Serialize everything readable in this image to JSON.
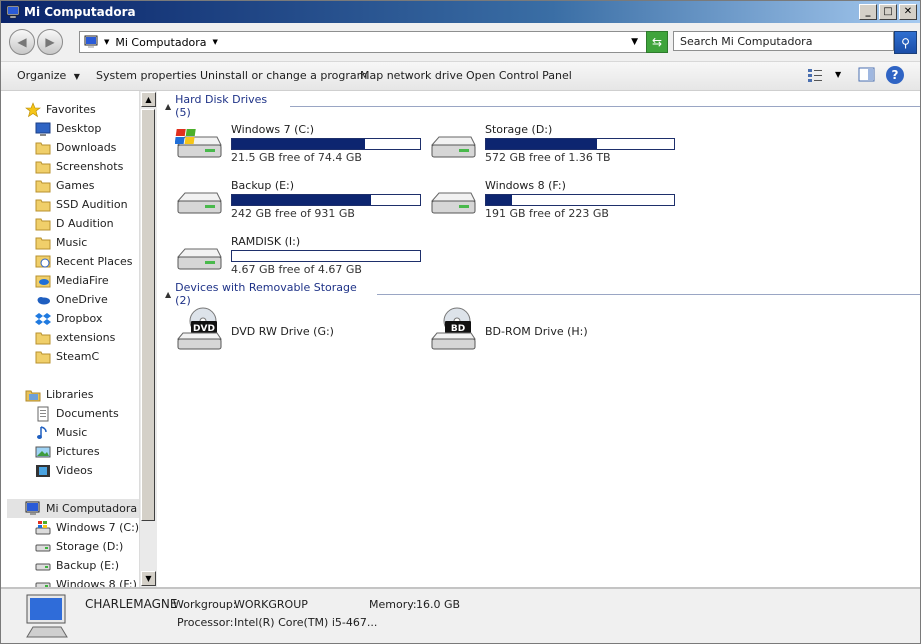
{
  "window": {
    "title": "Mi Computadora"
  },
  "address": {
    "path": "Mi Computadora",
    "search_placeholder": "Search Mi Computadora"
  },
  "toolbar": {
    "organize": "Organize",
    "system_properties": "System properties",
    "uninstall": "Uninstall or change a program",
    "map_network": "Map network drive",
    "control_panel": "Open Control Panel"
  },
  "nav": {
    "favorites": "Favorites",
    "favorites_items": [
      "Desktop",
      "Downloads",
      "Screenshots",
      "Games",
      "SSD Audition",
      "D Audition",
      "Music",
      "Recent Places",
      "MediaFire",
      "OneDrive",
      "Dropbox",
      "extensions",
      "SteamC"
    ],
    "libraries": "Libraries",
    "library_items": [
      "Documents",
      "Music",
      "Pictures",
      "Videos"
    ],
    "computer": "Mi Computadora",
    "computer_items": [
      "Windows 7 (C:)",
      "Storage (D:)",
      "Backup (E:)",
      "Windows 8 (F:)"
    ]
  },
  "groups": {
    "hdd": "Hard Disk Drives (5)",
    "removable": "Devices with Removable Storage (2)"
  },
  "drives": [
    {
      "name": "Windows 7 (C:)",
      "free": "21.5 GB free of 74.4 GB",
      "used_fraction": 0.71
    },
    {
      "name": "Storage (D:)",
      "free": "572 GB free of 1.36 TB",
      "used_fraction": 0.59
    },
    {
      "name": "Backup (E:)",
      "free": "242 GB free of 931 GB",
      "used_fraction": 0.74
    },
    {
      "name": "Windows 8 (F:)",
      "free": "191 GB free of 223 GB",
      "used_fraction": 0.14
    },
    {
      "name": "RAMDISK (I:)",
      "free": "4.67 GB free of 4.67 GB",
      "used_fraction": 0.0
    }
  ],
  "removable": [
    {
      "name": "DVD RW Drive (G:)",
      "badge": "DVD"
    },
    {
      "name": "BD-ROM Drive (H:)",
      "badge": "BD"
    }
  ],
  "details": {
    "computer_name": "CHARLEMAGNE",
    "workgroup_label": "Workgroup:",
    "workgroup": "WORKGROUP",
    "memory_label": "Memory:",
    "memory": "16.0 GB",
    "processor_label": "Processor:",
    "processor": "Intel(R) Core(TM) i5-467..."
  },
  "colors": {
    "bar_fill": "#0d2570",
    "title_start": "#0a246a",
    "group_text": "#1e3287"
  }
}
